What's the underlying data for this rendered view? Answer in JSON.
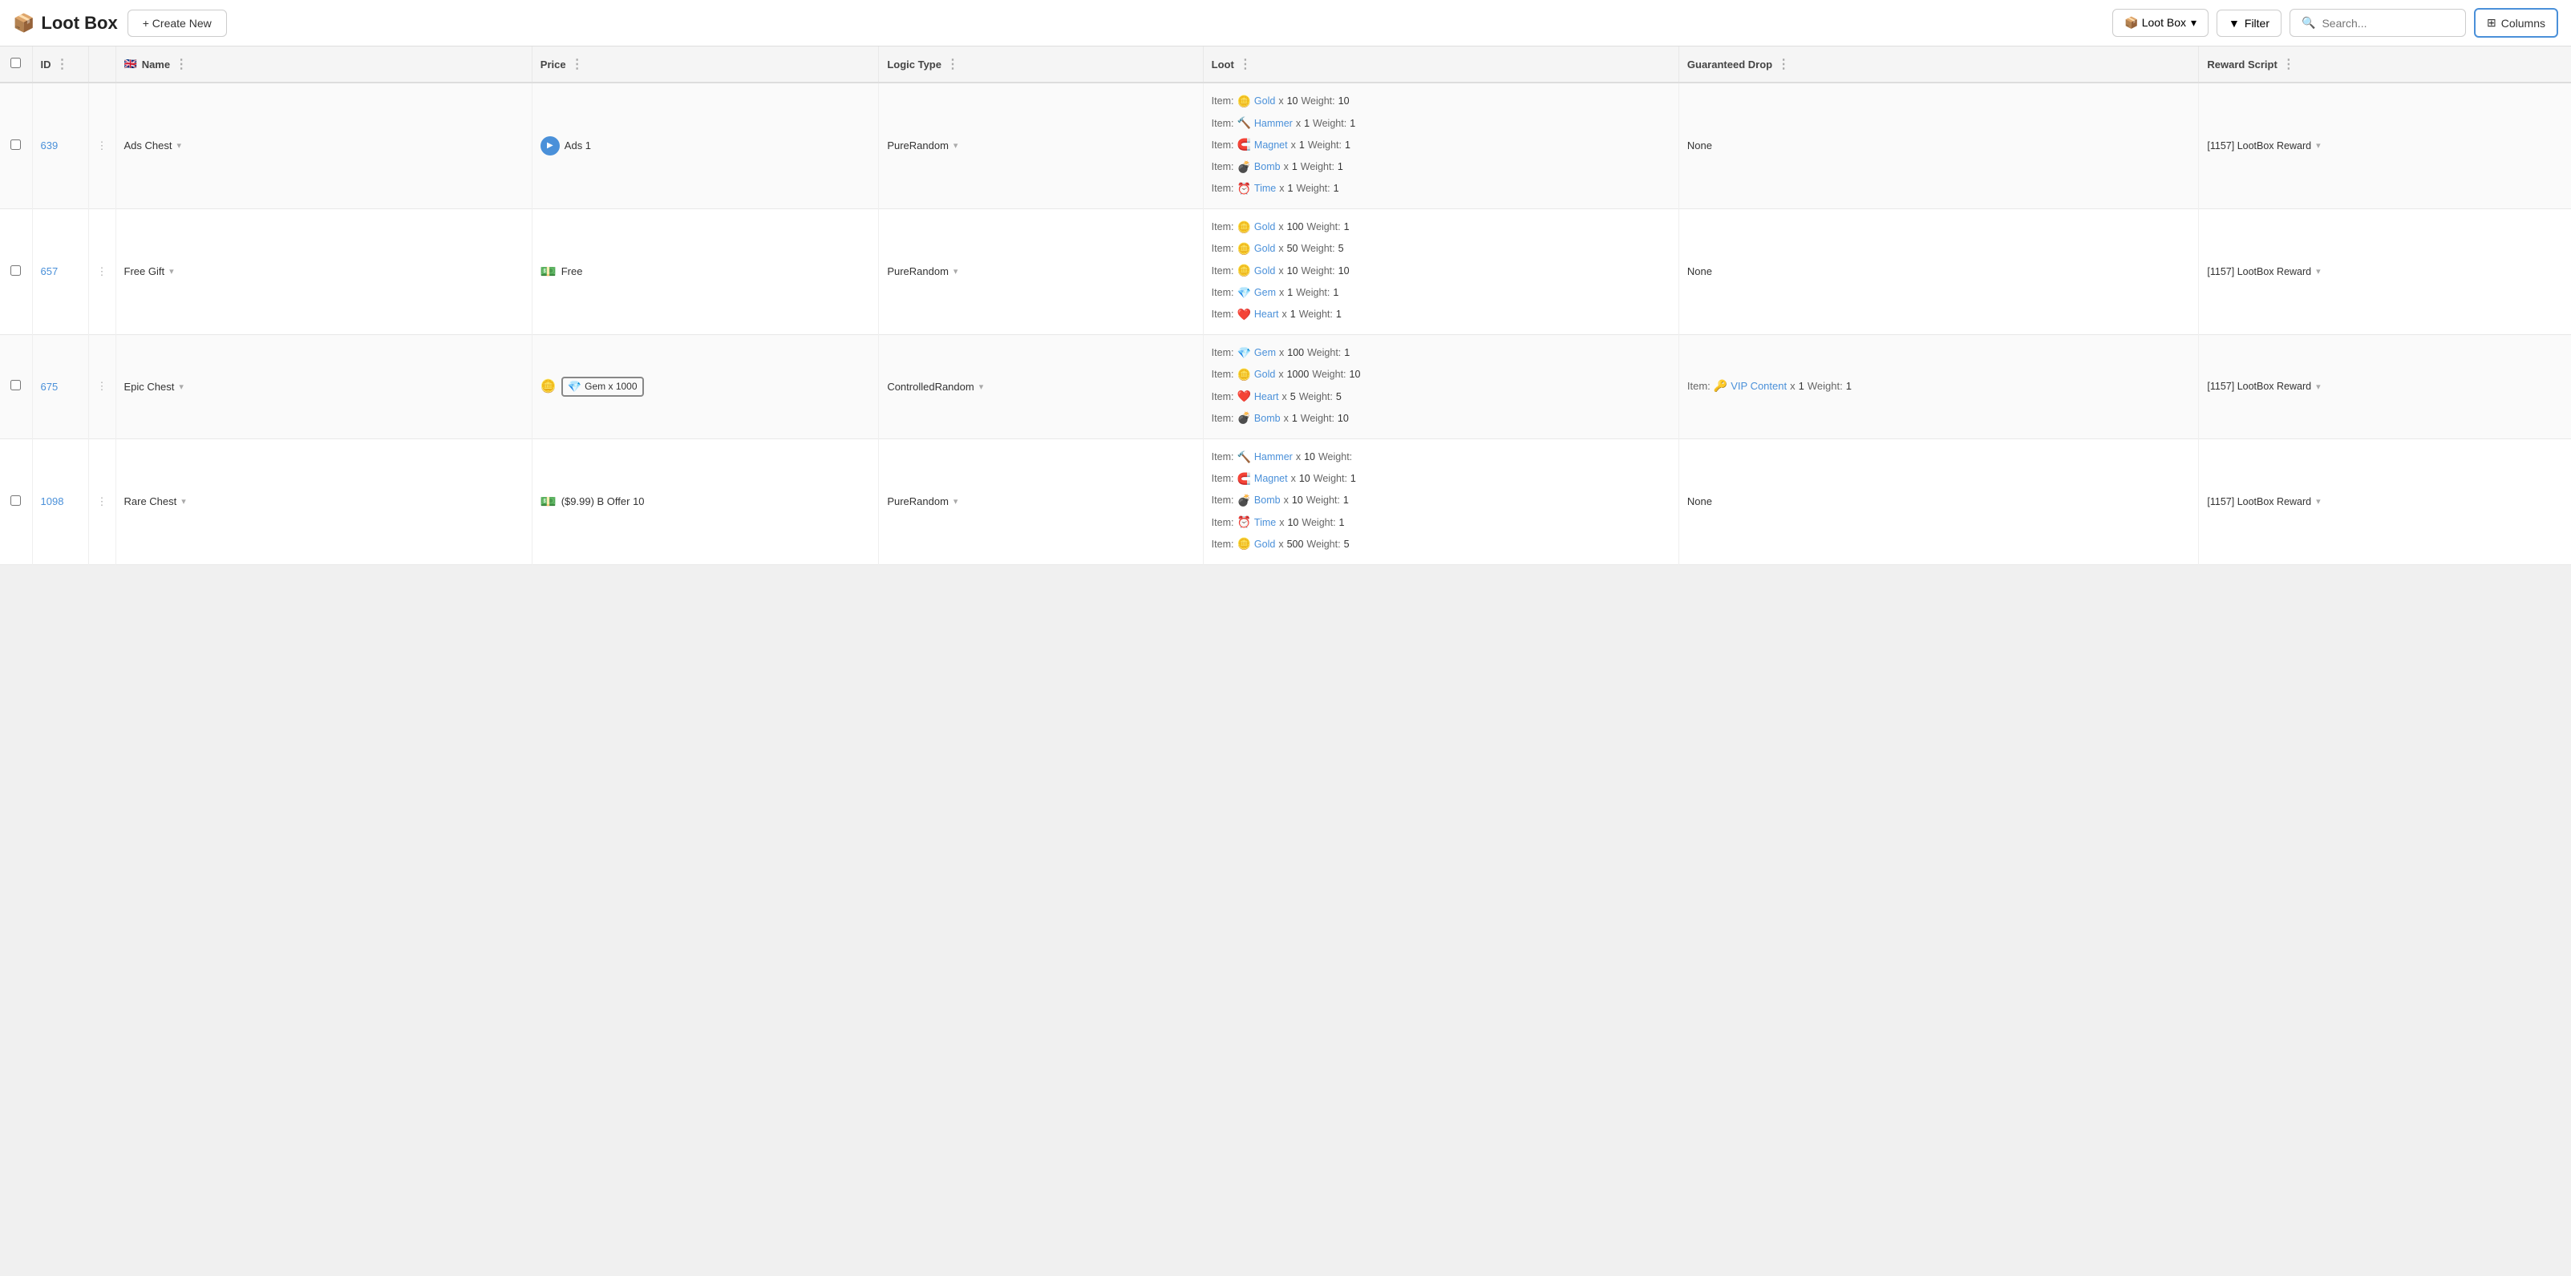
{
  "app": {
    "title": "Loot Box",
    "icon": "📦"
  },
  "toolbar": {
    "create_new_label": "+ Create New",
    "lootbox_dropdown_label": "📦 Loot Box",
    "filter_label": "Filter",
    "search_placeholder": "Search...",
    "columns_label": "Columns"
  },
  "table": {
    "columns": [
      {
        "id": "checkbox",
        "label": ""
      },
      {
        "id": "id",
        "label": "ID"
      },
      {
        "id": "actions",
        "label": ""
      },
      {
        "id": "name",
        "label": "🇬🇧 Name"
      },
      {
        "id": "price",
        "label": "Price"
      },
      {
        "id": "logic_type",
        "label": "Logic Type"
      },
      {
        "id": "loot",
        "label": "Loot"
      },
      {
        "id": "guaranteed_drop",
        "label": "Guaranteed Drop"
      },
      {
        "id": "reward_script",
        "label": "Reward Script"
      }
    ],
    "rows": [
      {
        "id": "639",
        "name": "Ads Chest",
        "price_icon": "▶",
        "price_type": "ads",
        "price_label": "Ads 1",
        "logic_type": "PureRandom",
        "loot_items": [
          {
            "emoji": "🪙",
            "name": "Gold",
            "qty": "10",
            "weight": "10"
          },
          {
            "emoji": "🔨",
            "name": "Hammer",
            "qty": "1",
            "weight": "1"
          },
          {
            "emoji": "🧲",
            "name": "Magnet",
            "qty": "1",
            "weight": "1"
          },
          {
            "emoji": "💣",
            "name": "Bomb",
            "qty": "1",
            "weight": "1"
          },
          {
            "emoji": "⏰",
            "name": "Time",
            "qty": "1",
            "weight": "1"
          }
        ],
        "guaranteed_drop": "None",
        "reward_script": "[1157] LootBox Reward"
      },
      {
        "id": "657",
        "name": "Free Gift",
        "price_icon": "💵",
        "price_type": "free",
        "price_label": "Free",
        "logic_type": "PureRandom",
        "loot_items": [
          {
            "emoji": "🪙",
            "name": "Gold",
            "qty": "100",
            "weight": "1"
          },
          {
            "emoji": "🪙",
            "name": "Gold",
            "qty": "50",
            "weight": "5"
          },
          {
            "emoji": "🪙",
            "name": "Gold",
            "qty": "10",
            "weight": "10"
          },
          {
            "emoji": "💎",
            "name": "Gem",
            "qty": "1",
            "weight": "1"
          },
          {
            "emoji": "❤️",
            "name": "Heart",
            "qty": "1",
            "weight": "1"
          }
        ],
        "guaranteed_drop": "None",
        "reward_script": "[1157] LootBox Reward"
      },
      {
        "id": "675",
        "name": "Epic Chest",
        "price_icon": "🪙",
        "price_type": "gem",
        "price_gem": "💎",
        "price_gem_label": "Gem x 1000",
        "logic_type": "ControlledRandom",
        "loot_items": [
          {
            "emoji": "💎",
            "name": "Gem",
            "qty": "100",
            "weight": "1"
          },
          {
            "emoji": "🪙",
            "name": "Gold",
            "qty": "1000",
            "weight": "10"
          },
          {
            "emoji": "❤️",
            "name": "Heart",
            "qty": "5",
            "weight": "5"
          },
          {
            "emoji": "💣",
            "name": "Bomb",
            "qty": "1",
            "weight": "10"
          }
        ],
        "guaranteed_drop_items": [
          {
            "emoji": "🔑",
            "name": "VIP Content",
            "qty": "1",
            "weight": "1"
          }
        ],
        "guaranteed_drop": "Item: 🔑 VIP Content x 1 Weight: 1",
        "reward_script": "[1157] LootBox Reward"
      },
      {
        "id": "1098",
        "name": "Rare Chest",
        "price_icon": "💵",
        "price_type": "bundle",
        "price_label": "($9.99) B Offer 10",
        "logic_type": "PureRandom",
        "loot_items": [
          {
            "emoji": "🔨",
            "name": "Hammer",
            "qty": "10",
            "weight": ""
          },
          {
            "emoji": "🧲",
            "name": "Magnet",
            "qty": "10",
            "weight": "1"
          },
          {
            "emoji": "💣",
            "name": "Bomb",
            "qty": "10",
            "weight": "1"
          },
          {
            "emoji": "⏰",
            "name": "Time",
            "qty": "10",
            "weight": "1"
          },
          {
            "emoji": "🪙",
            "name": "Gold",
            "qty": "500",
            "weight": "5"
          }
        ],
        "guaranteed_drop": "None",
        "reward_script": "[1157] LootBox Reward"
      }
    ]
  }
}
